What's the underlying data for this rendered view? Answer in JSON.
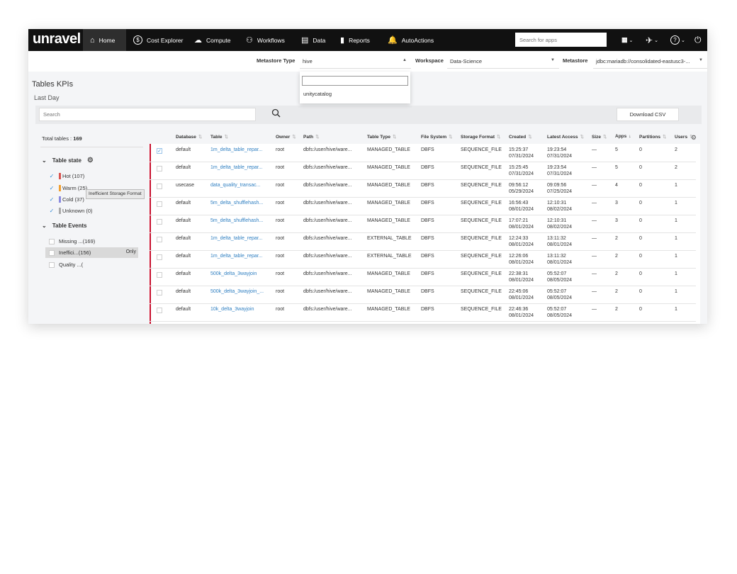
{
  "nav": {
    "logo": "unravel",
    "items": [
      {
        "label": "Home",
        "icon": "⌂"
      },
      {
        "label": "Cost Explorer",
        "icon": "$"
      },
      {
        "label": "Compute",
        "icon": "☁"
      },
      {
        "label": "Workflows",
        "icon": "⚇"
      },
      {
        "label": "Data",
        "icon": "▤"
      },
      {
        "label": "Reports",
        "icon": "▮"
      },
      {
        "label": "AutoActions",
        "icon": "🔔"
      }
    ],
    "search_placeholder": "Search for apps",
    "right_icons": {
      "apps": "⋮⋮⋮",
      "caret": "⌄",
      "rocket": "✈",
      "help": "?",
      "power": "⏻"
    }
  },
  "filters": {
    "metastore_type_label": "Metastore Type",
    "metastore_type_value": "hive",
    "workspace_label": "Workspace",
    "workspace_value": "Data-Science",
    "metastore_label": "Metastore",
    "metastore_value": "jdbc:mariadb://consolidated-eastusc3-...",
    "dropdown_option": "unitycatalog"
  },
  "page": {
    "title": "Tables KPIs",
    "subtitle": "Last Day",
    "search_placeholder": "Search",
    "download_label": "Download CSV"
  },
  "left": {
    "total_label": "Total tables : ",
    "total_value": "169",
    "table_state_label": "Table state",
    "states": [
      {
        "label": "Hot (107)",
        "color": "#d9534f"
      },
      {
        "label": "Warm (25)",
        "color": "#f0a030"
      },
      {
        "label": "Cold (37)",
        "color": "#8a8adf"
      },
      {
        "label": "Unknown (0)",
        "color": "#aaaaaa"
      }
    ],
    "table_events_label": "Table Events",
    "events": [
      {
        "label": "Missing ...(169)"
      },
      {
        "label": "Ineffici...(156)"
      },
      {
        "label": "Quality ...("
      }
    ],
    "only_label": "Only",
    "tooltip": "Inefficient Storage Format"
  },
  "table": {
    "headers": [
      "Database",
      "Table",
      "Owner",
      "Path",
      "Table Type",
      "File System",
      "Storage Format",
      "Created",
      "Latest Access",
      "Size",
      "Apps",
      "Partitions",
      "Users"
    ],
    "rows": [
      {
        "db": "default",
        "table": "1m_delta_table_repar...",
        "owner": "root",
        "path": "dbfs:/user/hive/ware...",
        "type": "MANAGED_TABLE",
        "fs": "DBFS",
        "fmt": "SEQUENCE_FILE",
        "c1": "15:25:37",
        "c2": "07/31/2024",
        "a1": "19:23:54",
        "a2": "07/31/2024",
        "size": "—",
        "apps": "5",
        "parts": "0",
        "users": "2"
      },
      {
        "db": "default",
        "table": "1m_delta_table_repar...",
        "owner": "root",
        "path": "dbfs:/user/hive/ware...",
        "type": "MANAGED_TABLE",
        "fs": "DBFS",
        "fmt": "SEQUENCE_FILE",
        "c1": "15:25:45",
        "c2": "07/31/2024",
        "a1": "19:23:54",
        "a2": "07/31/2024",
        "size": "—",
        "apps": "5",
        "parts": "0",
        "users": "2"
      },
      {
        "db": "usecase",
        "table": "data_quality_transac...",
        "owner": "root",
        "path": "dbfs:/user/hive/ware...",
        "type": "MANAGED_TABLE",
        "fs": "DBFS",
        "fmt": "SEQUENCE_FILE",
        "c1": "09:56:12",
        "c2": "05/29/2024",
        "a1": "09:09:56",
        "a2": "07/25/2024",
        "size": "—",
        "apps": "4",
        "parts": "0",
        "users": "1"
      },
      {
        "db": "default",
        "table": "5m_delta_shufflehash...",
        "owner": "root",
        "path": "dbfs:/user/hive/ware...",
        "type": "MANAGED_TABLE",
        "fs": "DBFS",
        "fmt": "SEQUENCE_FILE",
        "c1": "16:56:43",
        "c2": "08/01/2024",
        "a1": "12:10:31",
        "a2": "08/02/2024",
        "size": "—",
        "apps": "3",
        "parts": "0",
        "users": "1"
      },
      {
        "db": "default",
        "table": "5m_delta_shufflehash...",
        "owner": "root",
        "path": "dbfs:/user/hive/ware...",
        "type": "MANAGED_TABLE",
        "fs": "DBFS",
        "fmt": "SEQUENCE_FILE",
        "c1": "17:07:21",
        "c2": "08/01/2024",
        "a1": "12:10:31",
        "a2": "08/02/2024",
        "size": "—",
        "apps": "3",
        "parts": "0",
        "users": "1"
      },
      {
        "db": "default",
        "table": "1m_delta_table_repar...",
        "owner": "root",
        "path": "dbfs:/user/hive/ware...",
        "type": "EXTERNAL_TABLE",
        "fs": "DBFS",
        "fmt": "SEQUENCE_FILE",
        "c1": "12:24:33",
        "c2": "08/01/2024",
        "a1": "13:11:32",
        "a2": "08/01/2024",
        "size": "—",
        "apps": "2",
        "parts": "0",
        "users": "1"
      },
      {
        "db": "default",
        "table": "1m_delta_table_repar...",
        "owner": "root",
        "path": "dbfs:/user/hive/ware...",
        "type": "EXTERNAL_TABLE",
        "fs": "DBFS",
        "fmt": "SEQUENCE_FILE",
        "c1": "12:26:06",
        "c2": "08/01/2024",
        "a1": "13:11:32",
        "a2": "08/01/2024",
        "size": "—",
        "apps": "2",
        "parts": "0",
        "users": "1"
      },
      {
        "db": "default",
        "table": "500k_delta_3wayjoin",
        "owner": "root",
        "path": "dbfs:/user/hive/ware...",
        "type": "MANAGED_TABLE",
        "fs": "DBFS",
        "fmt": "SEQUENCE_FILE",
        "c1": "22:38:31",
        "c2": "08/01/2024",
        "a1": "05:52:07",
        "a2": "08/05/2024",
        "size": "—",
        "apps": "2",
        "parts": "0",
        "users": "1"
      },
      {
        "db": "default",
        "table": "500k_delta_3wayjoin_...",
        "owner": "root",
        "path": "dbfs:/user/hive/ware...",
        "type": "MANAGED_TABLE",
        "fs": "DBFS",
        "fmt": "SEQUENCE_FILE",
        "c1": "22:45:06",
        "c2": "08/01/2024",
        "a1": "05:52:07",
        "a2": "08/05/2024",
        "size": "—",
        "apps": "2",
        "parts": "0",
        "users": "1"
      },
      {
        "db": "default",
        "table": "10k_delta_3wayjoin",
        "owner": "root",
        "path": "dbfs:/user/hive/ware...",
        "type": "MANAGED_TABLE",
        "fs": "DBFS",
        "fmt": "SEQUENCE_FILE",
        "c1": "22:46:36",
        "c2": "08/01/2024",
        "a1": "05:52:07",
        "a2": "08/05/2024",
        "size": "—",
        "apps": "2",
        "parts": "0",
        "users": "1"
      }
    ]
  }
}
